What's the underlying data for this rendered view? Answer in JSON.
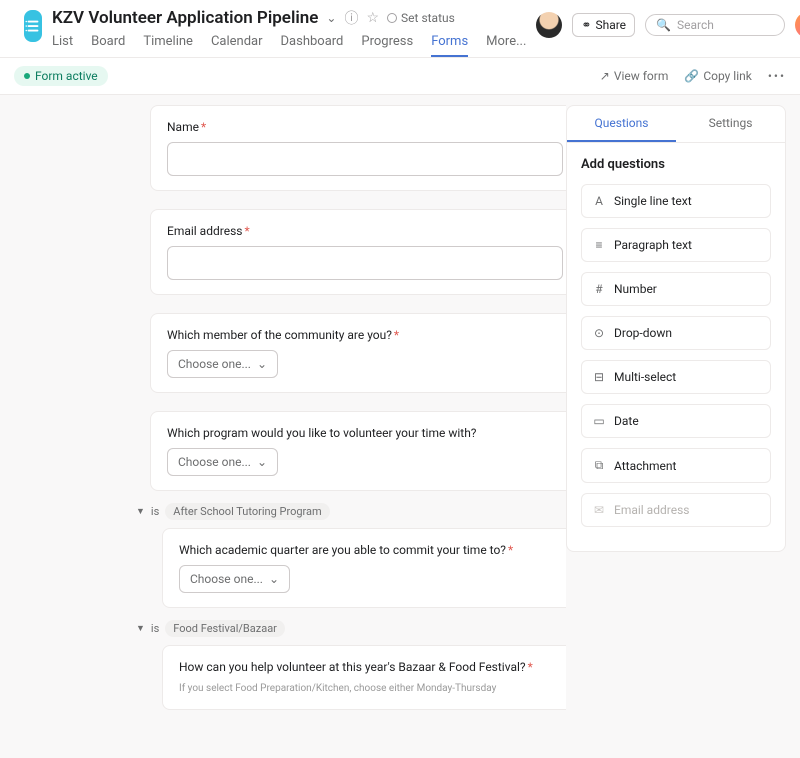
{
  "header": {
    "title": "KZV Volunteer Application Pipeline",
    "status_label": "Set status",
    "tabs": [
      "List",
      "Board",
      "Timeline",
      "Calendar",
      "Dashboard",
      "Progress",
      "Forms",
      "More..."
    ],
    "active_tab": "Forms",
    "share_label": "Share",
    "search_placeholder": "Search"
  },
  "toolbar": {
    "form_active": "Form active",
    "view_form": "View form",
    "copy_link": "Copy link"
  },
  "form": {
    "fields": [
      {
        "label": "Name",
        "required": true,
        "kind": "text"
      },
      {
        "label": "Email address",
        "required": true,
        "kind": "text"
      },
      {
        "label": "Which member of the community are you?",
        "required": true,
        "kind": "select",
        "placeholder": "Choose one..."
      },
      {
        "label": "Which program would you like to volunteer your time with?",
        "required": false,
        "kind": "select",
        "placeholder": "Choose one..."
      }
    ],
    "branch1": {
      "prefix": "is",
      "chip": "After School Tutoring Program",
      "label": "Which academic quarter are you able to commit your time to?",
      "required": true,
      "placeholder": "Choose one..."
    },
    "branch2": {
      "prefix": "is",
      "chip": "Food Festival/Bazaar",
      "label": "How can you help volunteer at this year's Bazaar & Food Festival?",
      "required": true,
      "helper": "If you select Food Preparation/Kitchen, choose either Monday-Thursday"
    }
  },
  "sidebar": {
    "tabs": [
      "Questions",
      "Settings"
    ],
    "active": "Questions",
    "heading": "Add questions",
    "types": [
      {
        "label": "Single line text",
        "icon": "A"
      },
      {
        "label": "Paragraph text",
        "icon": "≡"
      },
      {
        "label": "Number",
        "icon": "#"
      },
      {
        "label": "Drop-down",
        "icon": "⊙"
      },
      {
        "label": "Multi-select",
        "icon": "⊟"
      },
      {
        "label": "Date",
        "icon": "▭"
      },
      {
        "label": "Attachment",
        "icon": "⧉"
      },
      {
        "label": "Email address",
        "icon": "✉",
        "disabled": true
      }
    ]
  }
}
